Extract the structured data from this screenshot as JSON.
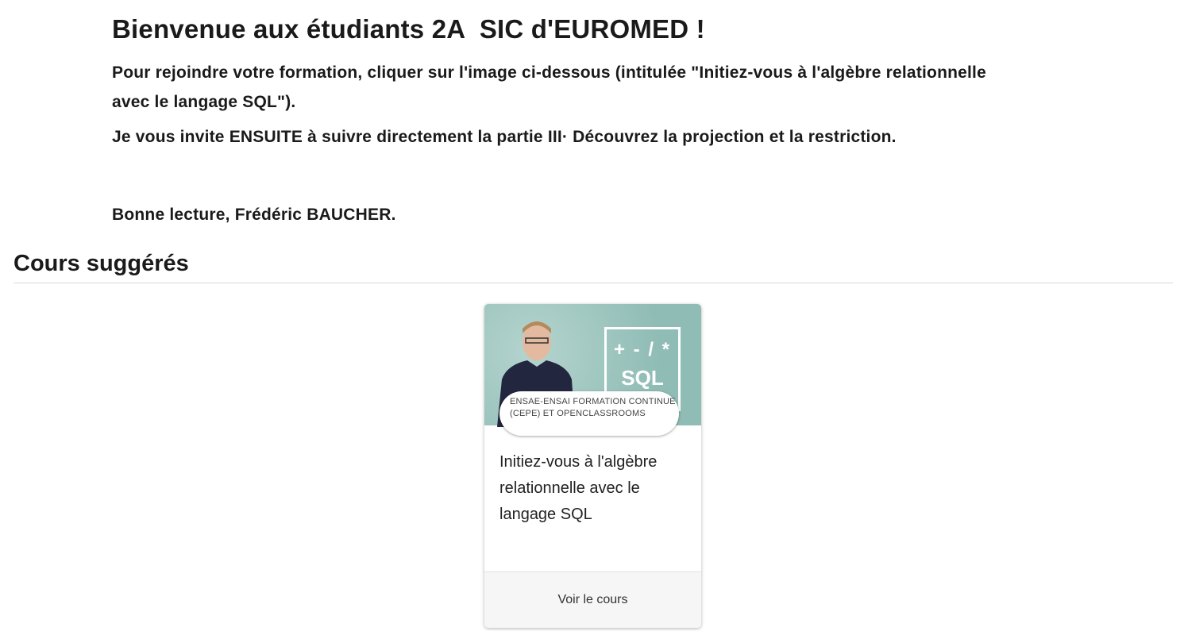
{
  "intro": {
    "heading": "Bienvenue aux étudiants 2A  SIC d'EUROMED !",
    "paragraph1": "Pour rejoindre votre formation, cliquer sur l'image ci-dessous (intitulée \"Initiez-vous à l'algèbre relationnelle avec le langage SQL\").",
    "paragraph2": "Je vous invite ENSUITE à suivre directement la partie III· Découvrez la projection et la restriction.",
    "signature": "Bonne lecture, Frédéric BAUCHER."
  },
  "suggested": {
    "heading": "Cours suggérés",
    "courses": [
      {
        "image_ops": "+ - / *",
        "image_label": "SQL",
        "provider": "ENSAE-ENSAI FORMATION CONTINUE (CEPE) ET OPENCLASSROOMS",
        "title": "Initiez-vous à l'algèbre relationnelle avec le langage SQL",
        "action": "Voir le cours",
        "image_color": "#8fbcb5"
      }
    ]
  }
}
